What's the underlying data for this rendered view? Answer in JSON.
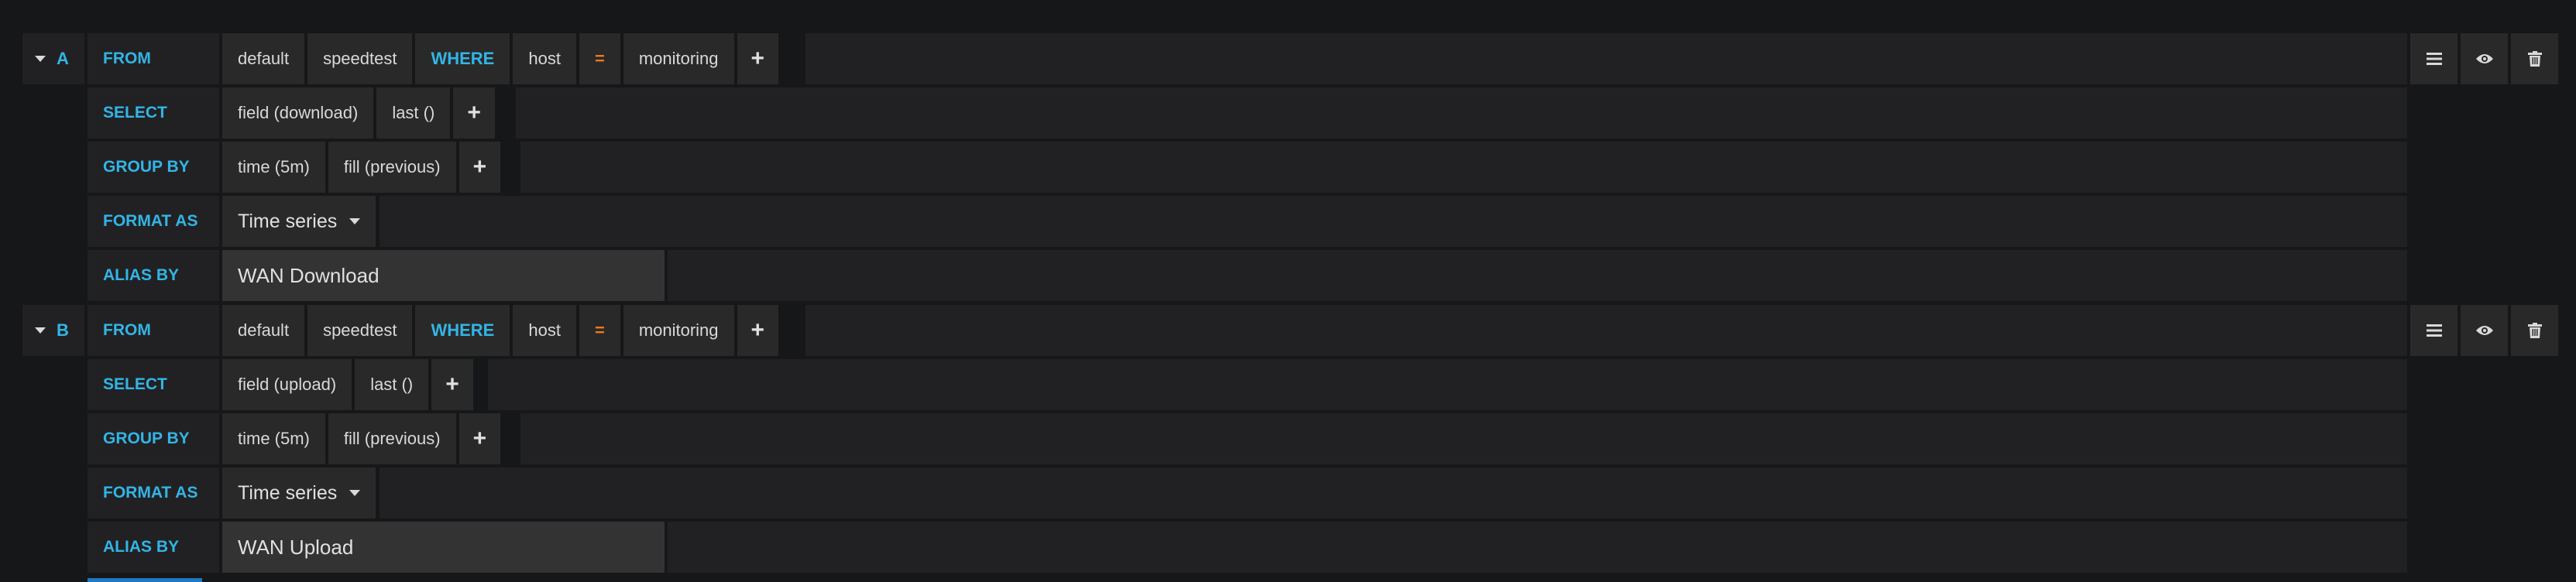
{
  "queries": [
    {
      "letter": "A",
      "from_label": "FROM",
      "from": [
        "default",
        "speedtest"
      ],
      "where_label": "WHERE",
      "where": {
        "key": "host",
        "op": "=",
        "value": "monitoring"
      },
      "select_label": "SELECT",
      "select": [
        "field (download)",
        "last ()"
      ],
      "group_by_label": "GROUP BY",
      "group_by": [
        "time (5m)",
        "fill (previous)"
      ],
      "format_label": "FORMAT AS",
      "format_value": "Time series",
      "alias_label": "ALIAS BY",
      "alias_value": "WAN Download"
    },
    {
      "letter": "B",
      "from_label": "FROM",
      "from": [
        "default",
        "speedtest"
      ],
      "where_label": "WHERE",
      "where": {
        "key": "host",
        "op": "=",
        "value": "monitoring"
      },
      "select_label": "SELECT",
      "select": [
        "field (upload)",
        "last ()"
      ],
      "group_by_label": "GROUP BY",
      "group_by": [
        "time (5m)",
        "fill (previous)"
      ],
      "format_label": "FORMAT AS",
      "format_value": "Time series",
      "alias_label": "ALIAS BY",
      "alias_value": "WAN Upload"
    }
  ],
  "plus": "+",
  "icons": [
    "hamburger-menu-icon",
    "eye-icon",
    "trash-icon",
    "caret-down-icon",
    "plus-icon"
  ],
  "colors": {
    "keyword": "#33b5e5",
    "operator": "#eb7b18",
    "background": "#161719",
    "segment": "#292929"
  }
}
